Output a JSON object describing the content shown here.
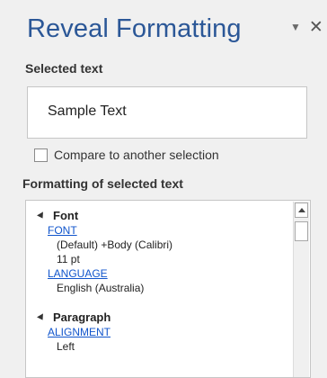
{
  "pane": {
    "title": "Reveal Formatting",
    "controls": {
      "options_icon": "dropdown-triangle",
      "close_icon": "close-x"
    }
  },
  "selected_text": {
    "label": "Selected text",
    "sample": "Sample Text",
    "compare_label": "Compare to another selection",
    "compare_checked": false
  },
  "formatting": {
    "label": "Formatting of selected text",
    "groups": [
      {
        "title": "Font",
        "entries": [
          {
            "link": "FONT",
            "values": [
              "(Default) +Body (Calibri)",
              "11 pt"
            ]
          },
          {
            "link": "LANGUAGE",
            "values": [
              "English (Australia)"
            ]
          }
        ]
      },
      {
        "title": "Paragraph",
        "entries": [
          {
            "link": "ALIGNMENT",
            "values": [
              "Left"
            ]
          }
        ]
      }
    ]
  },
  "colors": {
    "title": "#2b5797",
    "link": "#1155cc",
    "background": "#f0f0f0"
  }
}
